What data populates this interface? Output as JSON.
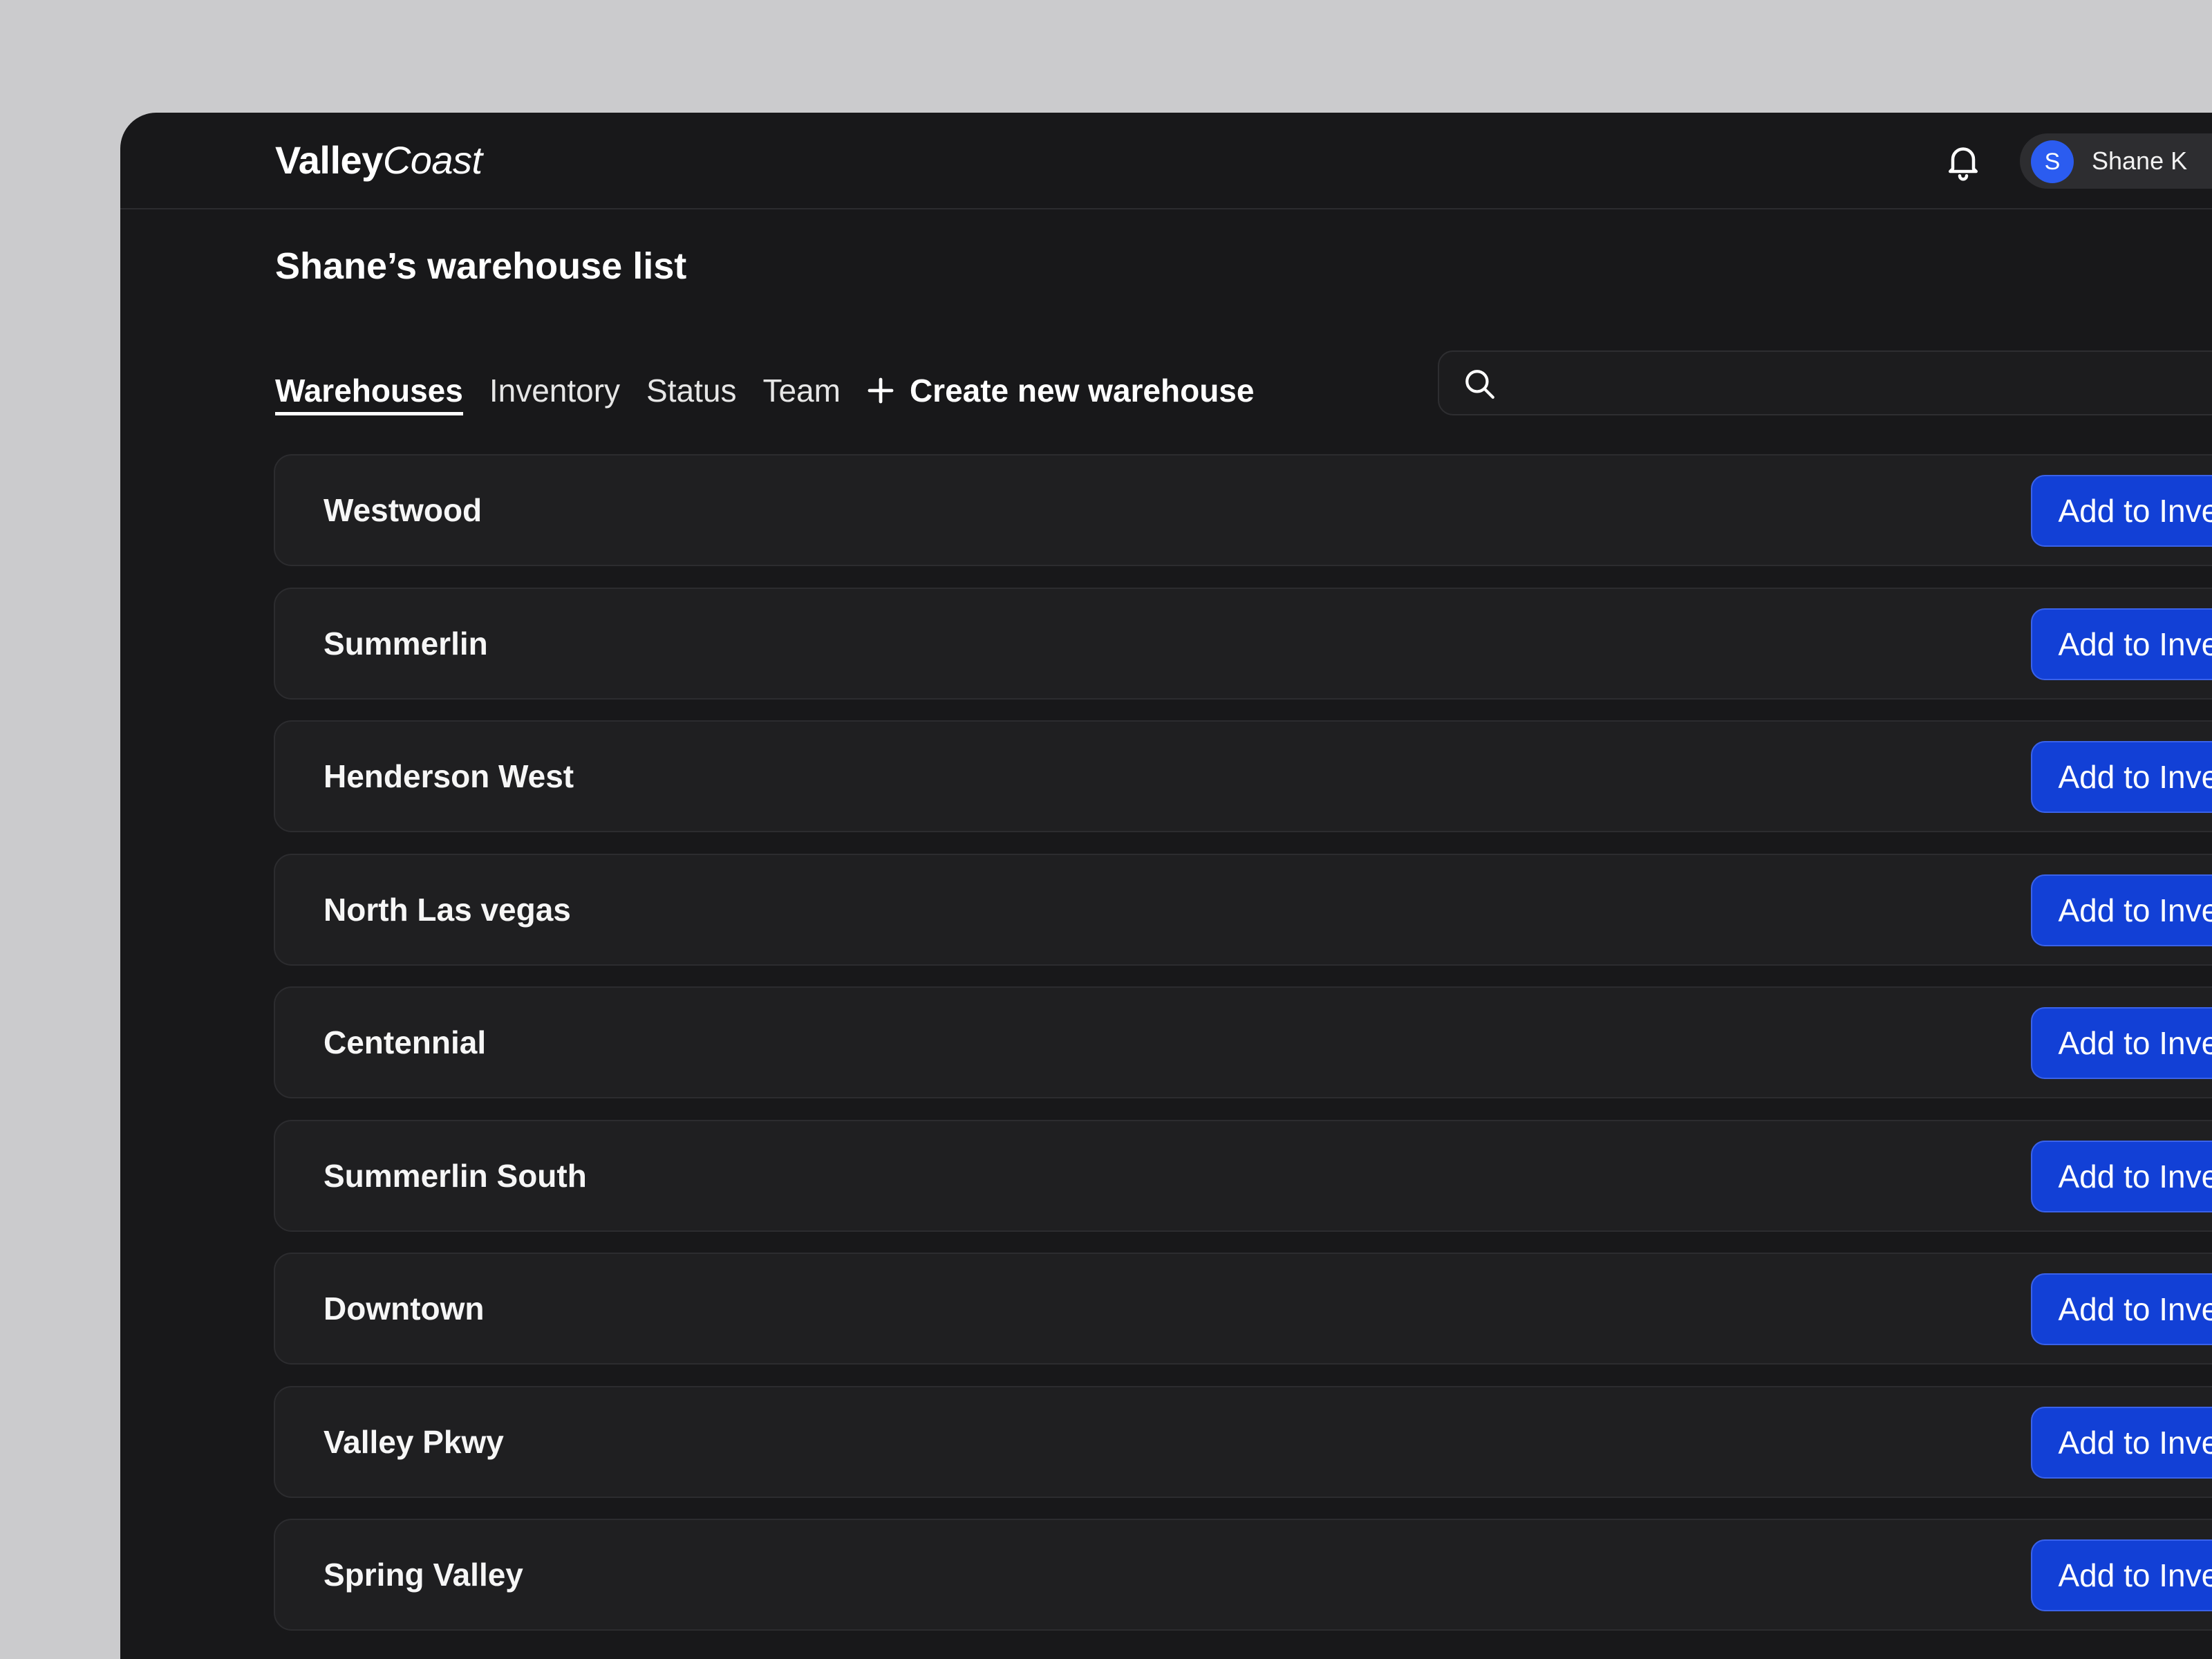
{
  "app": {
    "logo_bold": "Valley",
    "logo_italic": "Coast"
  },
  "header": {
    "notifications_icon": "bell-icon",
    "user": {
      "avatar_initial": "S",
      "name": "Shane K"
    }
  },
  "page": {
    "title": "Shane’s warehouse list"
  },
  "tabs": [
    {
      "label": "Warehouses",
      "active": true
    },
    {
      "label": "Inventory",
      "active": false
    },
    {
      "label": "Status",
      "active": false
    },
    {
      "label": "Team",
      "active": false
    }
  ],
  "create_action": {
    "icon": "plus-icon",
    "label": "Create new warehouse"
  },
  "search": {
    "icon": "search-icon",
    "value": "",
    "placeholder": ""
  },
  "warehouses": [
    {
      "name": "Westwood",
      "action_label": "Add to Inventory"
    },
    {
      "name": "Summerlin",
      "action_label": "Add to Inventory"
    },
    {
      "name": "Henderson West",
      "action_label": "Add to Inventory"
    },
    {
      "name": "North Las vegas",
      "action_label": "Add to Inventory"
    },
    {
      "name": "Centennial",
      "action_label": "Add to Inventory"
    },
    {
      "name": "Summerlin South",
      "action_label": "Add to Inventory"
    },
    {
      "name": "Downtown",
      "action_label": "Add to Inventory"
    },
    {
      "name": "Valley Pkwy",
      "action_label": "Add to Inventory"
    },
    {
      "name": "Spring Valley",
      "action_label": "Add to Inventory"
    }
  ],
  "colors": {
    "background": "#cbcbcd",
    "window": "#18181a",
    "row": "#1f1f21",
    "accent": "#1240d6",
    "avatar": "#2b5cf0"
  }
}
